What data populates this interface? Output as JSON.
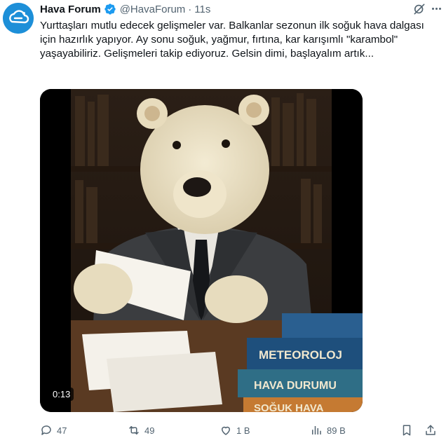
{
  "author": {
    "name": "Hava Forum",
    "handle": "@HavaForum",
    "separator": "·",
    "time": "11s",
    "verified": true,
    "avatar_icon": "cloud-sun-logo-icon",
    "avatar_color": "#1d8fd8"
  },
  "tweet": {
    "text": "Yurttaşları mutlu edecek gelişmeler var. Balkanlar sezonun ilk soğuk hava dalgası için hazırlık yapıyor. Ay sonu soğuk, yağmur, fırtına, kar karışımlı \"karambol\" yaşayabiliriz. Gelişmeleri takip ediyoruz. Gelsin dimi, başlayalım artık..."
  },
  "media": {
    "type": "video",
    "duration": "0:13",
    "book_titles": [
      "METEOROLOJ",
      "HAVA DURUMU",
      "SOĞUK HAVA"
    ]
  },
  "actions": {
    "replies": "47",
    "reposts": "49",
    "likes": "1 B",
    "views": "89 B"
  },
  "colors": {
    "text": "#0f1419",
    "secondary": "#536471",
    "verified_blue": "#1d9bf0"
  }
}
